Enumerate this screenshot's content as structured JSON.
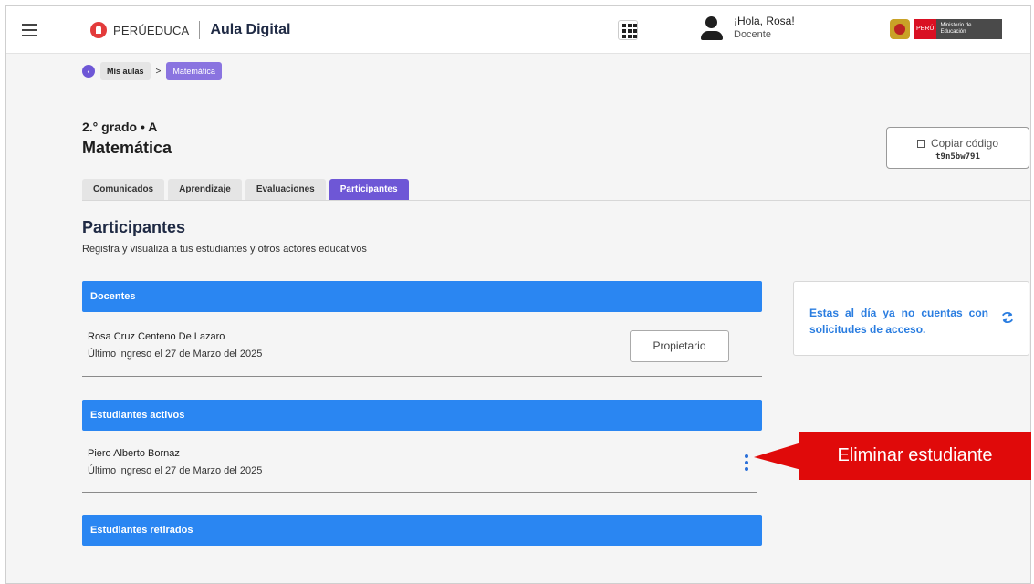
{
  "header": {
    "brand": "PERÚEDUCA",
    "app_name": "Aula Digital",
    "greeting": "¡Hola, Rosa!",
    "role": "Docente",
    "minedu_peru": "PERÚ",
    "minedu_name": "Ministerio de Educación"
  },
  "breadcrumb": {
    "back_icon": "‹",
    "parent": "Mis aulas",
    "separator": ">",
    "current": "Matemática"
  },
  "classroom": {
    "grade": "2.° grado • A",
    "course": "Matemática",
    "copy_label": "Copiar código",
    "code": "t9n5bw791"
  },
  "tabs": [
    {
      "label": "Comunicados"
    },
    {
      "label": "Aprendizaje"
    },
    {
      "label": "Evaluaciones"
    },
    {
      "label": "Participantes",
      "active": true
    }
  ],
  "section": {
    "title": "Participantes",
    "subtitle": "Registra y visualiza a tus estudiantes y otros actores educativos"
  },
  "docentes": {
    "header": "Docentes",
    "name": "Rosa Cruz Centeno De Lazaro",
    "last_login": "Último ingreso el 27 de Marzo del 2025",
    "badge": "Propietario"
  },
  "activos": {
    "header": "Estudiantes activos",
    "name": "Piero Alberto Bornaz",
    "last_login": "Último ingreso el 27 de Marzo del 2025"
  },
  "retirados": {
    "header": "Estudiantes retirados"
  },
  "requests": {
    "message": "Estas al día ya no cuentas con solicitudes de acceso."
  },
  "callout": {
    "text": "Eliminar estudiante"
  },
  "colors": {
    "primary_blue": "#2a86f2",
    "tab_purple": "#6e57d6",
    "callout_red": "#e00a0a"
  }
}
